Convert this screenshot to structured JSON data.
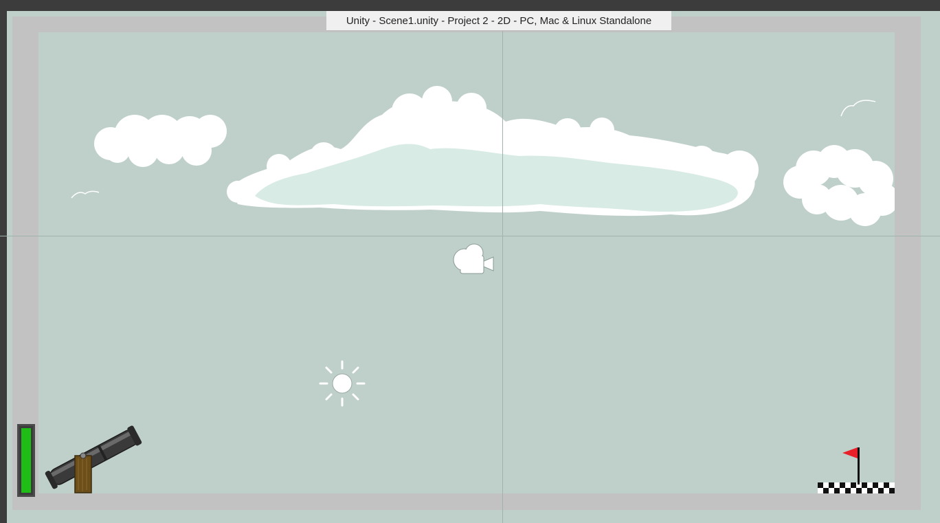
{
  "window": {
    "title": "Unity - Scene1.unity - Project 2 - 2D - PC, Mac & Linux Standalone"
  },
  "scene": {
    "background_color": "#bfd0ca",
    "frame_color": "#c2c2c2",
    "gizmos": [
      "camera-icon",
      "directional-light-icon"
    ]
  },
  "hud": {
    "health_fraction": 1.0,
    "health_color": "#1fbe16"
  },
  "sprites": [
    "cannon",
    "goal-flag",
    "finish-line",
    "clouds",
    "birds"
  ],
  "flag_color": "#e8202a"
}
